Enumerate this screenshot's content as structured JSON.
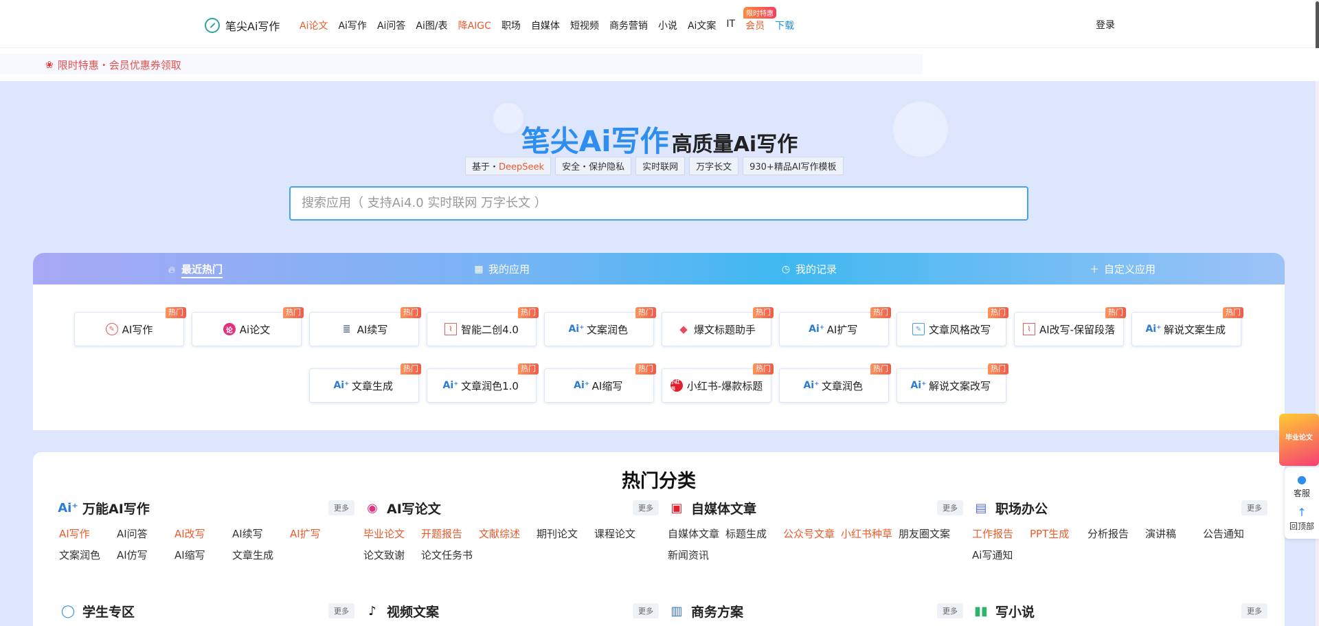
{
  "brand": {
    "name": "笔尖Ai写作"
  },
  "nav": {
    "items": [
      {
        "label": "Ai论文",
        "style": "red"
      },
      {
        "label": "Ai写作",
        "style": ""
      },
      {
        "label": "Ai问答",
        "style": ""
      },
      {
        "label": "Ai图/表",
        "style": ""
      },
      {
        "label": "降AIGC",
        "style": "red"
      },
      {
        "label": "职场",
        "style": ""
      },
      {
        "label": "自媒体",
        "style": ""
      },
      {
        "label": "短视频",
        "style": ""
      },
      {
        "label": "商务营销",
        "style": ""
      },
      {
        "label": "小说",
        "style": ""
      },
      {
        "label": "Ai文案",
        "style": ""
      },
      {
        "label": "IT",
        "style": ""
      },
      {
        "label": "会员",
        "style": "red"
      },
      {
        "label": "下载",
        "style": "blue"
      }
    ],
    "promo_tag": "限时特惠",
    "login": "登录"
  },
  "banner": {
    "text": "限时特惠・会员优惠券领取"
  },
  "hero": {
    "title_main": "笔尖Ai写作",
    "title_sub": "高质量Ai写作",
    "tags": [
      {
        "prefix": "基于・",
        "highlight": "DeepSeek"
      },
      {
        "prefix": "安全・保护隐私",
        "highlight": ""
      },
      {
        "prefix": "实时联网",
        "highlight": ""
      },
      {
        "prefix": "万字长文",
        "highlight": ""
      },
      {
        "prefix": "930+精品AI写作模板",
        "highlight": ""
      }
    ],
    "search_placeholder": "搜索应用（ 支持Ai4.0 实时联网 万字长文 ）"
  },
  "panel": {
    "tabs": [
      "最近热门",
      "我的应用",
      "我的记录",
      "自定义应用"
    ],
    "hot_label": "热门",
    "apps_row1": [
      {
        "label": "AI写作",
        "icon": "circle-pen-icon"
      },
      {
        "label": "Ai论文",
        "icon": "paper-icon"
      },
      {
        "label": "AI续写",
        "icon": "stack-icon"
      },
      {
        "label": "智能二创4.0",
        "icon": "chart-box-icon"
      },
      {
        "label": "文案润色",
        "icon": "ai-icon"
      },
      {
        "label": "爆文标题助手",
        "icon": "tag-icon"
      },
      {
        "label": "AI扩写",
        "icon": "ai-icon"
      },
      {
        "label": "文章风格改写",
        "icon": "edit-icon"
      },
      {
        "label": "AI改写-保留段落",
        "icon": "chart-box-icon"
      },
      {
        "label": "解说文案生成",
        "icon": "ai-icon"
      }
    ],
    "apps_row2": [
      {
        "label": "文章生成",
        "icon": "ai-icon"
      },
      {
        "label": "文章润色1.0",
        "icon": "ai-icon"
      },
      {
        "label": "AI缩写",
        "icon": "ai-icon"
      },
      {
        "label": "小红书-爆款标题",
        "icon": "xiaohongshu-icon"
      },
      {
        "label": "文章润色",
        "icon": "ai-icon"
      },
      {
        "label": "解说文案改写",
        "icon": "ai-icon"
      }
    ]
  },
  "categories": {
    "title": "热门分类",
    "more_label": "更多",
    "groups": [
      {
        "name": "万能AI写作",
        "icon": "ai-icon",
        "links": [
          {
            "t": "AI写作",
            "o": true
          },
          {
            "t": "AI问答",
            "o": false
          },
          {
            "t": "AI改写",
            "o": true
          },
          {
            "t": "AI续写",
            "o": false
          },
          {
            "t": "AI扩写",
            "o": true
          },
          {
            "t": "文案润色",
            "o": false
          },
          {
            "t": "AI仿写",
            "o": false
          },
          {
            "t": "AI缩写",
            "o": false
          },
          {
            "t": "文章生成",
            "o": false
          }
        ]
      },
      {
        "name": "AI写论文",
        "icon": "paper-icon",
        "links": [
          {
            "t": "毕业论文",
            "o": true
          },
          {
            "t": "开题报告",
            "o": true
          },
          {
            "t": "文献综述",
            "o": true
          },
          {
            "t": "期刊论文",
            "o": false
          },
          {
            "t": "课程论文",
            "o": false
          },
          {
            "t": "论文致谢",
            "o": false
          },
          {
            "t": "论文任务书",
            "o": false
          }
        ]
      },
      {
        "name": "自媒体文章",
        "icon": "media-icon",
        "links": [
          {
            "t": "自媒体文章",
            "o": false
          },
          {
            "t": "标题生成",
            "o": false
          },
          {
            "t": "公众号文章",
            "o": true
          },
          {
            "t": "小红书种草",
            "o": true
          },
          {
            "t": "朋友圈文案",
            "o": false
          },
          {
            "t": "新闻资讯",
            "o": false
          }
        ]
      },
      {
        "name": "职场办公",
        "icon": "briefcase-icon",
        "links": [
          {
            "t": "工作报告",
            "o": true
          },
          {
            "t": "PPT生成",
            "o": true
          },
          {
            "t": "分析报告",
            "o": false
          },
          {
            "t": "演讲稿",
            "o": false
          },
          {
            "t": "公告通知",
            "o": false
          },
          {
            "t": "Ai写通知",
            "o": false
          }
        ]
      }
    ],
    "row2": [
      {
        "name": "学生专区",
        "icon": "student-icon"
      },
      {
        "name": "视频文案",
        "icon": "tiktok-icon"
      },
      {
        "name": "商务方案",
        "icon": "business-icon"
      },
      {
        "name": "写小说",
        "icon": "book-icon"
      }
    ]
  },
  "floating": {
    "promo": "毕业论文",
    "service": "客服",
    "top": "回顶部"
  }
}
